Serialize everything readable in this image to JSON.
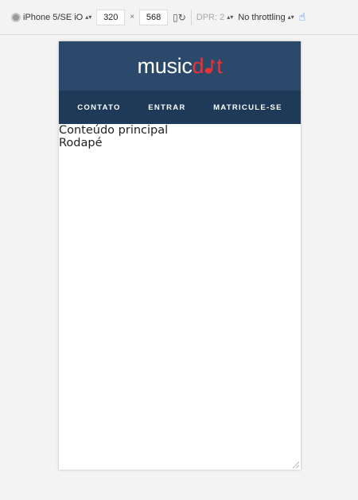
{
  "devtools": {
    "device": "iPhone 5/SE iO",
    "width": "320",
    "times": "×",
    "height": "568",
    "dpr": "DPR: 2",
    "throttling": "No throttling",
    "caret": "⇕"
  },
  "site": {
    "logo": {
      "prefix": "music",
      "accent_letters": "d",
      "accent_rest": "t",
      "accent_color": "#e8333a"
    },
    "header_color": "#2b4a6b",
    "nav_color": "#1f3a58",
    "nav": [
      "CONTATO",
      "ENTRAR",
      "MATRICULE-SE"
    ],
    "main_content": "Conteúdo principal",
    "footer": "Rodapé"
  }
}
